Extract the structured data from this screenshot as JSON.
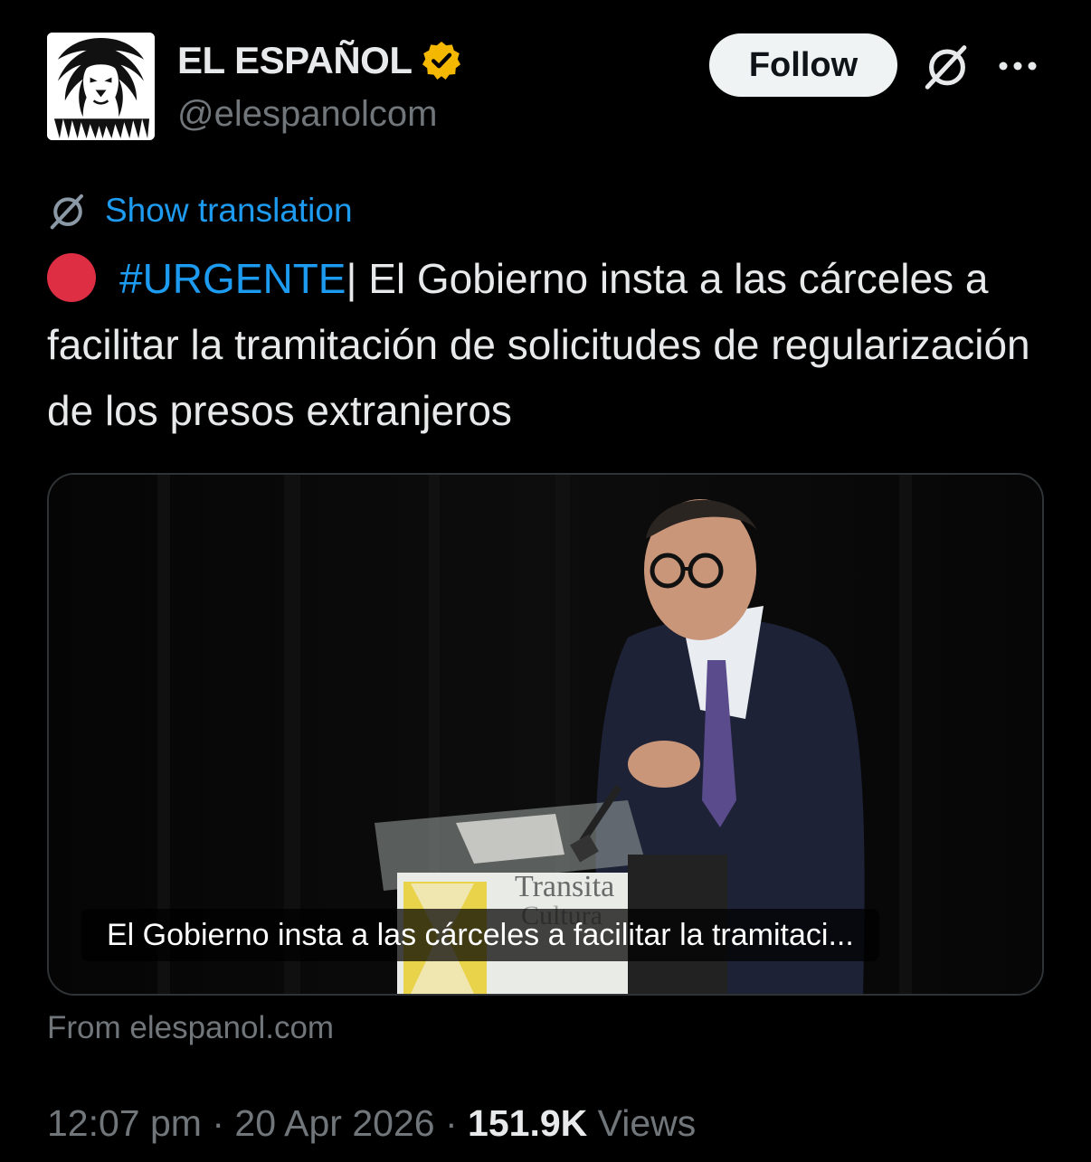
{
  "account": {
    "display_name": "EL ESPAÑOL",
    "handle": "@elespanolcom",
    "verified_color": "#f4b800"
  },
  "actions": {
    "follow_label": "Follow"
  },
  "translation": {
    "label": "Show translation"
  },
  "tweet": {
    "hashtag": "#URGENTE",
    "text": "| El Gobierno insta a las cárceles a facilitar la tramitación de solicitudes de regularización de los presos extranjeros"
  },
  "card": {
    "caption": "El Gobierno insta a las cárceles a facilitar la tramitaci...",
    "podium_text": "Transita",
    "podium_text2": "Cultura",
    "source": "From elespanol.com"
  },
  "meta": {
    "time": "12:07 pm",
    "separator": "·",
    "date": "20 Apr 2026",
    "views_count": "151.9K",
    "views_label": "Views"
  },
  "colors": {
    "background": "#000000",
    "link": "#1d9bf0",
    "muted": "#71767b",
    "urgent_dot": "#dd2e44"
  }
}
